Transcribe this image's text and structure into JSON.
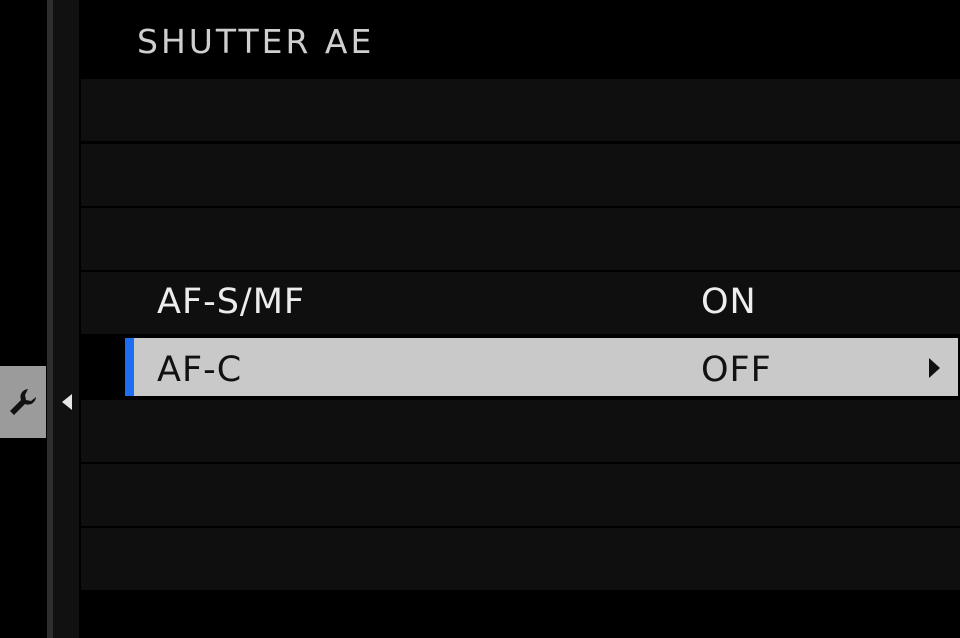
{
  "header": {
    "title": "SHUTTER AE"
  },
  "sidebar": {
    "tab_icon": "wrench-icon",
    "tab_arrow": "triangle-left-icon"
  },
  "menu": {
    "items": [
      {
        "label": "",
        "value": ""
      },
      {
        "label": "",
        "value": ""
      },
      {
        "label": "",
        "value": ""
      },
      {
        "label": "AF-S/MF",
        "value": "ON"
      },
      {
        "label": "AF-C",
        "value": "OFF",
        "selected": true,
        "chevron": "triangle-right-icon"
      },
      {
        "label": "",
        "value": ""
      },
      {
        "label": "",
        "value": ""
      },
      {
        "label": "",
        "value": ""
      }
    ]
  },
  "colors": {
    "background": "#000000",
    "row": "#0f0f0f",
    "selected_row": "#c9c9c9",
    "accent": "#1f6df0",
    "text": "#ededed"
  }
}
